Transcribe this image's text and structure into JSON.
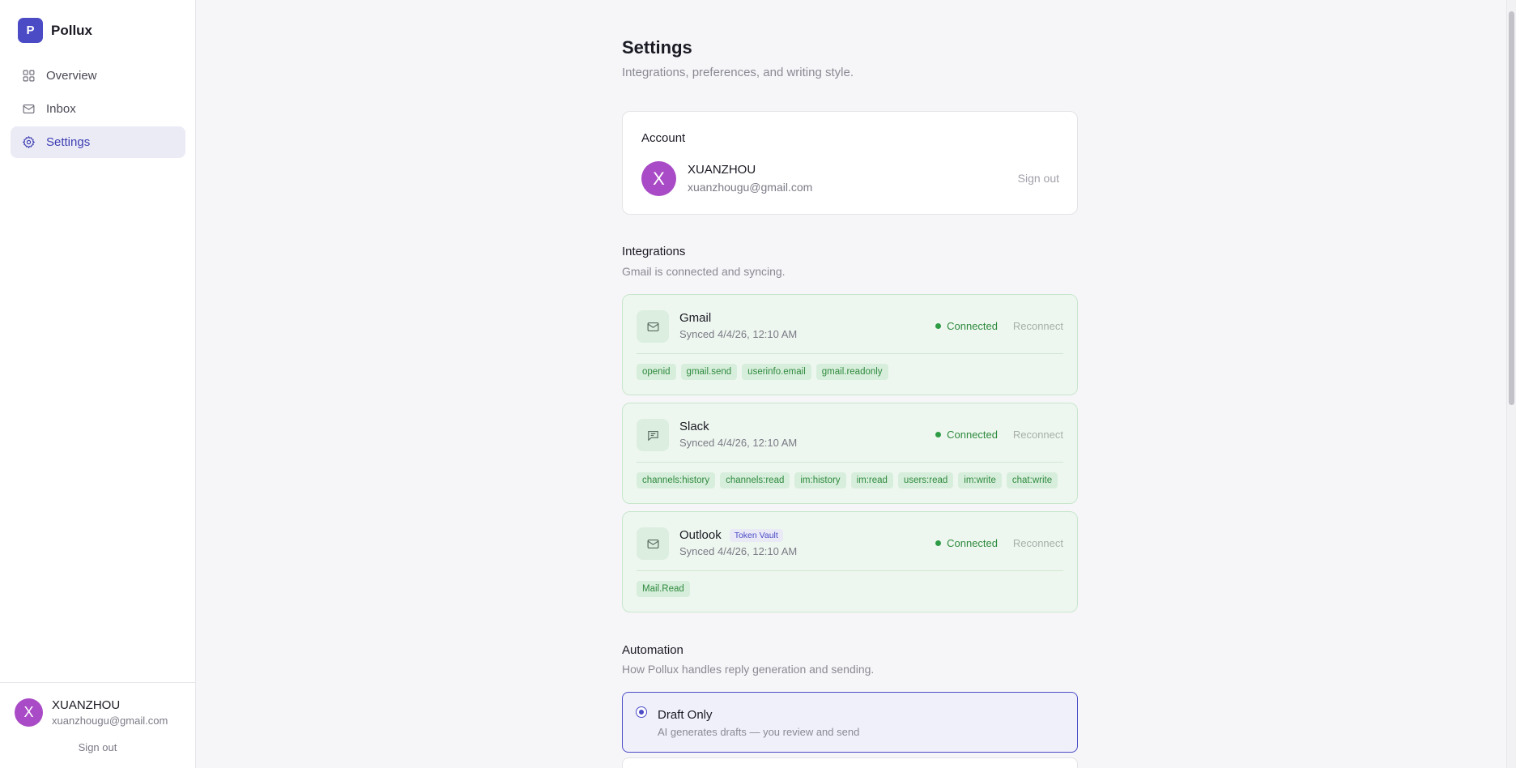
{
  "app": {
    "name": "Pollux",
    "logo_letter": "P"
  },
  "sidebar": {
    "items": [
      {
        "label": "Overview",
        "icon": "grid-icon",
        "active": false
      },
      {
        "label": "Inbox",
        "icon": "mail-icon",
        "active": false
      },
      {
        "label": "Settings",
        "icon": "gear-icon",
        "active": true
      }
    ],
    "user": {
      "initial": "X",
      "name": "XUANZHOU",
      "email": "xuanzhougu@gmail.com",
      "signout": "Sign out"
    }
  },
  "page": {
    "title": "Settings",
    "subtitle": "Integrations, preferences, and writing style."
  },
  "account": {
    "title": "Account",
    "initial": "X",
    "name": "XUANZHOU",
    "email": "xuanzhougu@gmail.com",
    "signout": "Sign out"
  },
  "integrations": {
    "title": "Integrations",
    "subtitle": "Gmail is connected and syncing.",
    "items": [
      {
        "name": "Gmail",
        "icon": "mail-icon",
        "badge": "",
        "synced": "Synced 4/4/26, 12:10 AM",
        "status": "Connected",
        "action": "Reconnect",
        "scopes": [
          "openid",
          "gmail.send",
          "userinfo.email",
          "gmail.readonly"
        ]
      },
      {
        "name": "Slack",
        "icon": "chat-icon",
        "badge": "",
        "synced": "Synced 4/4/26, 12:10 AM",
        "status": "Connected",
        "action": "Reconnect",
        "scopes": [
          "channels:history",
          "channels:read",
          "im:history",
          "im:read",
          "users:read",
          "im:write",
          "chat:write"
        ]
      },
      {
        "name": "Outlook",
        "icon": "mail-icon",
        "badge": "Token Vault",
        "synced": "Synced 4/4/26, 12:10 AM",
        "status": "Connected",
        "action": "Reconnect",
        "scopes": [
          "Mail.Read"
        ]
      }
    ]
  },
  "automation": {
    "title": "Automation",
    "subtitle": "How Pollux handles reply generation and sending.",
    "options": [
      {
        "label": "Draft Only",
        "desc": "AI generates drafts — you review and send",
        "selected": true
      }
    ]
  },
  "colors": {
    "accent": "#4b4bc6",
    "connected": "#2e8a3e",
    "avatar": "#a94bc6"
  }
}
